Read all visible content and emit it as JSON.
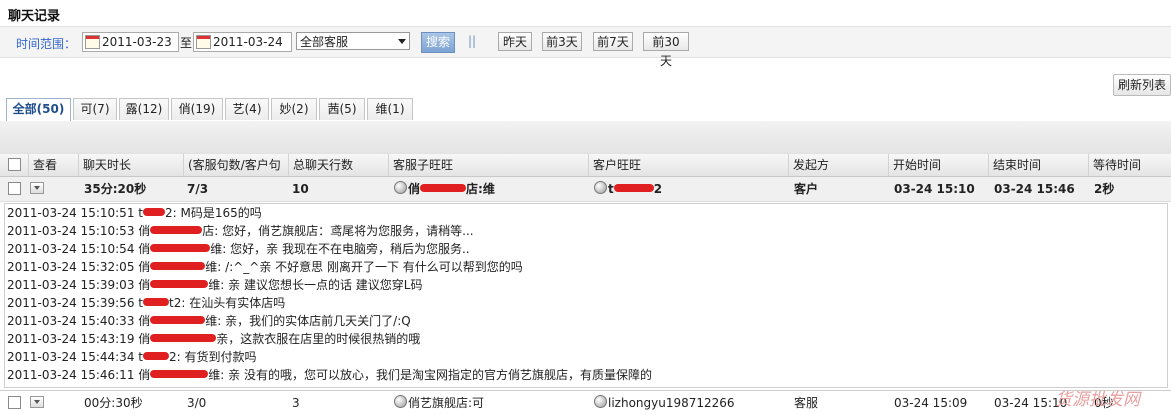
{
  "page": {
    "title": "聊天记录"
  },
  "filter": {
    "time_label": "时间范围：",
    "start_date": "2011-03-23",
    "to_label": "至",
    "end_date": "2011-03-24",
    "service_select": "全部客服",
    "search_label": "搜索",
    "separator": "||",
    "quick": [
      "昨天",
      "前3天",
      "前7天",
      "前30天"
    ]
  },
  "refresh_label": "刷新列表",
  "tabs": [
    {
      "label": "全部(50)",
      "active": true
    },
    {
      "label": "可(7)"
    },
    {
      "label": "露(12)"
    },
    {
      "label": "俏(19)"
    },
    {
      "label": "艺(4)"
    },
    {
      "label": "妙(2)"
    },
    {
      "label": "茜(5)"
    },
    {
      "label": "维(1)"
    }
  ],
  "table": {
    "headers": [
      "查看",
      "聊天时长",
      "(客服句数/客户句",
      "总聊天行数",
      "客服子旺旺",
      "客户旺旺",
      "发起方",
      "开始时间",
      "结束时间",
      "等待时间"
    ],
    "row1": {
      "duration": "35分:20秒",
      "ratio": "7/3",
      "total": "10",
      "agent_pre": "俏",
      "agent_post": "店:维",
      "customer_pre": "t",
      "customer_post": "2",
      "initiator": "客户",
      "start": "03-24 15:10",
      "end": "03-24 15:46",
      "wait": "2秒"
    },
    "row2": {
      "duration": "00分:30秒",
      "ratio": "3/0",
      "total": "3",
      "agent": "俏艺旗舰店:可",
      "customer": "lizhongyu198712266",
      "initiator": "客服",
      "start": "03-24 15:09",
      "end": "03-24 15:10",
      "wait": "0秒"
    }
  },
  "chat": [
    {
      "time": "2011-03-24 15:10:51",
      "pre": "t",
      "post": "2:",
      "text": " M码是165的吗"
    },
    {
      "time": "2011-03-24 15:10:53",
      "pre": "俏",
      "post": "店:",
      "text": " 您好，俏艺旗舰店：鸢尾将为您服务，请稍等..."
    },
    {
      "time": "2011-03-24 15:10:54",
      "pre": "俏",
      "post": "维:",
      "text": " 您好，亲 我现在不在电脑旁，稍后为您服务.."
    },
    {
      "time": "2011-03-24 15:32:05",
      "pre": "俏",
      "post": "维:",
      "text": " /:^_^亲 不好意思 刚离开了一下 有什么可以帮到您的吗"
    },
    {
      "time": "2011-03-24 15:39:03",
      "pre": "俏",
      "post": "维:",
      "text": " 亲 建议您想长一点的话 建议您穿L码"
    },
    {
      "time": "2011-03-24 15:39:56",
      "pre": "t",
      "post": "t2:",
      "text": " 在汕头有实体店吗"
    },
    {
      "time": "2011-03-24 15:40:33",
      "pre": "俏",
      "post": "维:",
      "text": " 亲，我们的实体店前几天关门了/:Q"
    },
    {
      "time": "2011-03-24 15:43:19",
      "pre": "俏",
      "post": "",
      "text": "亲，这款衣服在店里的时候很热销的哦"
    },
    {
      "time": "2011-03-24 15:44:34",
      "pre": "t",
      "post": "2:",
      "text": " 有货到付款吗"
    },
    {
      "time": "2011-03-24 15:46:11",
      "pre": "俏",
      "post": "维:",
      "text": " 亲 没有的哦，您可以放心，我们是淘宝网指定的官方俏艺旗舰店，有质量保障的"
    }
  ],
  "watermark": "货源批发网"
}
